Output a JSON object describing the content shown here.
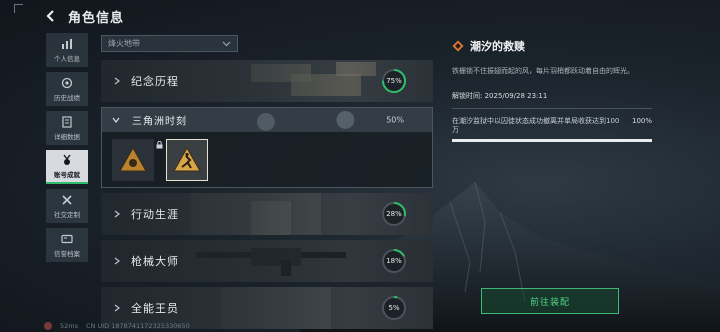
{
  "header": {
    "title": "角色信息",
    "back_icon": "back-arrow-icon"
  },
  "sidenav": {
    "items": [
      {
        "label": "个人信息",
        "icon": "bar-chart-icon"
      },
      {
        "label": "历史战绩",
        "icon": "target-icon"
      },
      {
        "label": "详细数据",
        "icon": "document-icon"
      },
      {
        "label": "账号成就",
        "icon": "medal-icon",
        "active": true
      },
      {
        "label": "社交定制",
        "icon": "tools-icon"
      },
      {
        "label": "信誉档案",
        "icon": "card-icon"
      }
    ]
  },
  "filter": {
    "value": "烽火地带"
  },
  "categories": [
    {
      "name": "纪念历程",
      "percent": 75,
      "percent_text": "75%"
    },
    {
      "name": "行动生涯",
      "percent": 28,
      "percent_text": "28%"
    },
    {
      "name": "枪械大师",
      "percent": 18,
      "percent_text": "18%"
    },
    {
      "name": "全能王员",
      "percent": 5,
      "percent_text": "5%"
    }
  ],
  "expanded": {
    "name": "三角洲时刻",
    "percent_text": "50%"
  },
  "detail": {
    "title": "潮汐的救赎",
    "description": "铁栅锁不住振翅而起的风，每片羽梢都跃动着自由的辉光。",
    "unlock_time": "解锁时间: 2025/09/28 23:11",
    "condition": "在潮汐监狱中以囚徒状态成功撤离并单局收获达到100万",
    "progress": 1.0,
    "progress_text": "100%"
  },
  "equip_button": {
    "label": "前往装配"
  },
  "footer": {
    "ping": "52ms",
    "uid": "CN UID 1878741172325330650"
  },
  "colors": {
    "accent_green": "#2ebd6b",
    "bg": "#1b232b"
  }
}
